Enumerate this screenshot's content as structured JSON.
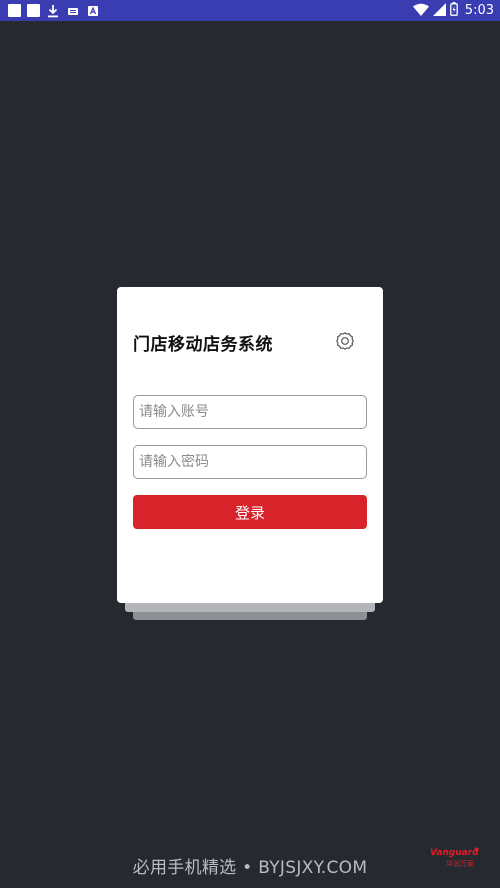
{
  "status_bar": {
    "time": "5:03",
    "left_icons": [
      "notification-square",
      "notification-square",
      "download-icon",
      "sd-card-icon",
      "a-letter-icon"
    ],
    "right_icons": [
      "wifi-icon",
      "cell-signal-icon",
      "battery-icon"
    ]
  },
  "login": {
    "title": "门店移动店务系统",
    "account_placeholder": "请输入账号",
    "password_placeholder": "请输入密码",
    "login_label": "登录",
    "settings_icon": "gear-icon"
  },
  "footer": {
    "text": "必用手机精选 • BYJSJXY.COM",
    "brand_name": "Vanguard",
    "brand_sub": "华润万家"
  },
  "colors": {
    "status_bar": "#3a3cb2",
    "background": "#272930",
    "accent": "#d9232b"
  }
}
